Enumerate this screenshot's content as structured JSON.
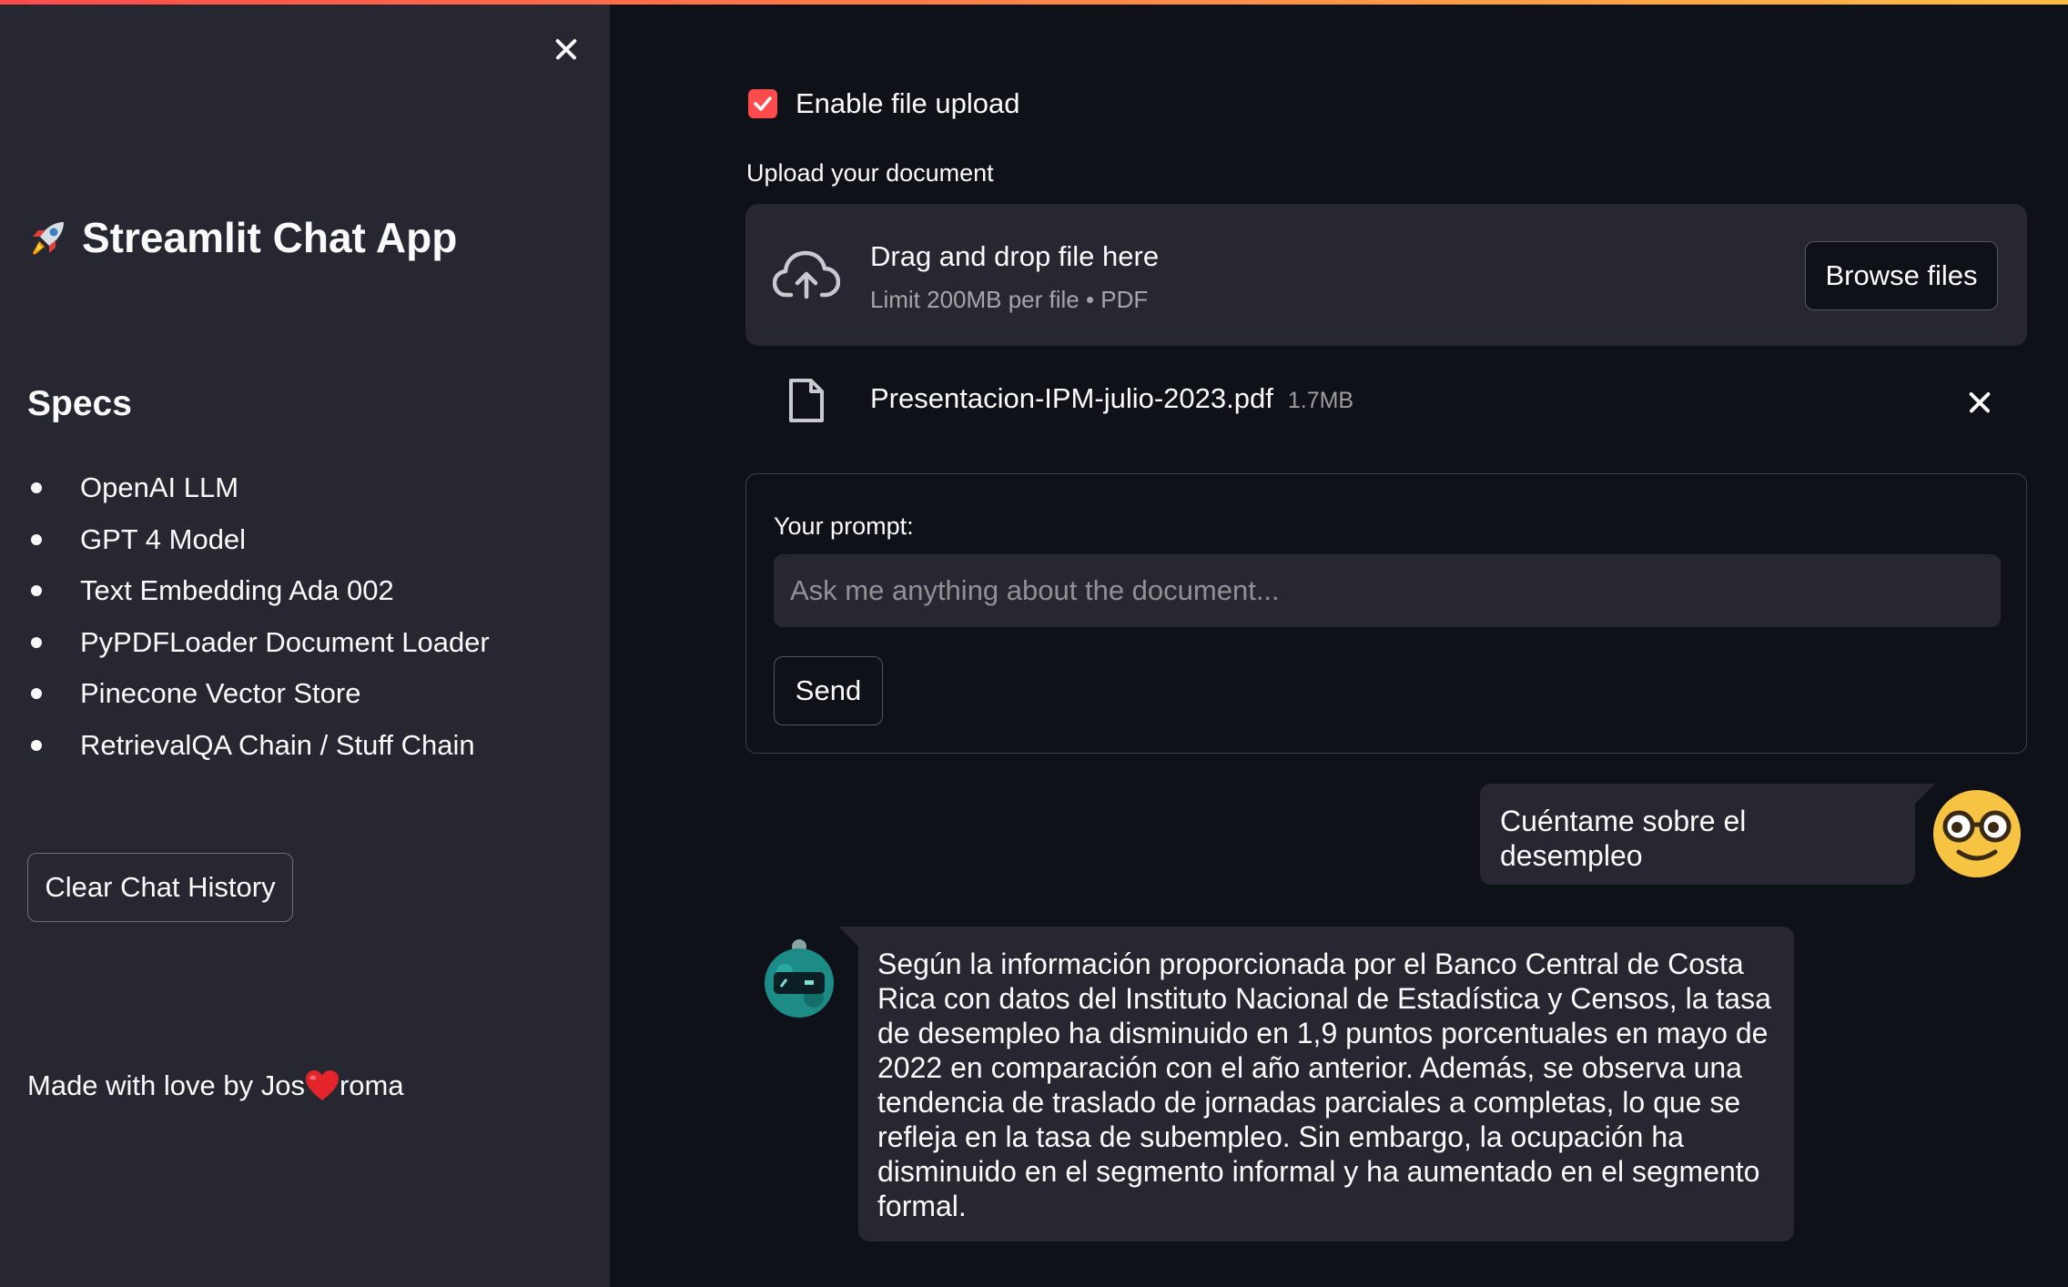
{
  "colors": {
    "accent": "#ff4b4b",
    "sidebar_bg": "#262730",
    "main_bg": "#0e1117",
    "text": "#fafafa"
  },
  "sidebar": {
    "close_icon": "close-icon",
    "app_title_icon": "rocket-icon",
    "app_title": "Streamlit Chat App",
    "specs_heading": "Specs",
    "specs": [
      "OpenAI LLM",
      "GPT 4 Model",
      "Text Embedding Ada 002",
      "PyPDFLoader Document Loader",
      "Pinecone Vector Store",
      "RetrievalQA Chain / Stuff Chain"
    ],
    "clear_button": "Clear Chat History",
    "footer_prefix": "Made with love by Jos",
    "footer_heart_icon": "heart-icon",
    "footer_suffix": "roma"
  },
  "main": {
    "enable_upload": {
      "label": "Enable file upload",
      "checked": true
    },
    "upload_label": "Upload your document",
    "dropzone": {
      "icon": "cloud-upload-icon",
      "title": "Drag and drop file here",
      "limit": "Limit 200MB per file • PDF",
      "browse_button": "Browse files"
    },
    "uploaded_file": {
      "icon": "file-icon",
      "name": "Presentacion-IPM-julio-2023.pdf",
      "size": "1.7MB",
      "remove_icon": "close-icon"
    },
    "form": {
      "prompt_label": "Your prompt:",
      "prompt_placeholder": "Ask me anything about the document...",
      "prompt_value": "",
      "send_button": "Send"
    },
    "chat": [
      {
        "role": "user",
        "avatar": "nerd-face-icon",
        "text": "Cuéntame sobre el desempleo"
      },
      {
        "role": "assistant",
        "avatar": "robot-icon",
        "text": "Según la información proporcionada por el Banco Central de Costa Rica con datos del Instituto Nacional de Estadística y Censos, la tasa de desempleo ha disminuido en 1,9 puntos porcentuales en mayo de 2022 en comparación con el año anterior. Además, se observa una tendencia de traslado de jornadas parciales a completas, lo que se refleja en la tasa de subempleo. Sin embargo, la ocupación ha disminuido en el segmento informal y ha aumentado en el segmento formal."
      }
    ]
  }
}
